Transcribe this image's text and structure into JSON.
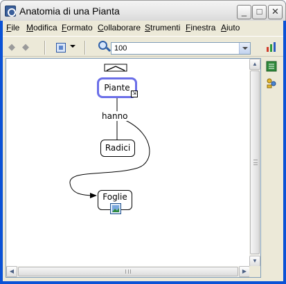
{
  "window": {
    "title": "Anatomia di una Pianta"
  },
  "title_buttons": {
    "minimize": "_",
    "maximize": "□",
    "close": "✕"
  },
  "menu": [
    "File",
    "Modifica",
    "Formato",
    "Collaborare",
    "Strumenti",
    "Finestra",
    "Aiuto"
  ],
  "toolbar": {
    "back_icon": "back-arrow-icon",
    "forward_icon": "forward-arrow-icon",
    "zoom_value": "100"
  },
  "concept_map": {
    "nodes": {
      "root": "Piante",
      "child1": "Radici",
      "child2": "Foglie"
    },
    "link_label": "hanno"
  },
  "colors": {
    "title_bar": "#e6e6e6",
    "selection": "#6a6ee8",
    "chrome": "#ece9d8"
  }
}
